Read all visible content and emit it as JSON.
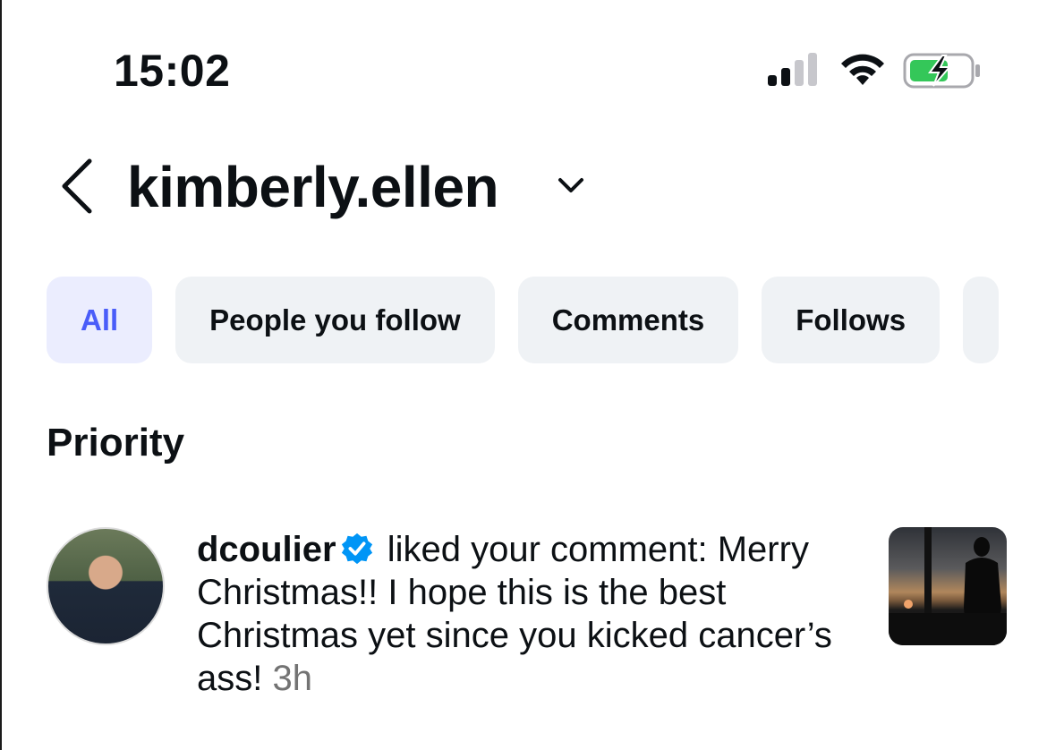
{
  "status_bar": {
    "time": "15:02",
    "icons": [
      "cellular-signal-icon",
      "wifi-icon",
      "battery-charging-icon"
    ],
    "battery_color": "#34c759"
  },
  "header": {
    "username": "kimberly.ellen",
    "icons": [
      "back-chevron-icon",
      "chevron-down-icon"
    ]
  },
  "tabs": [
    {
      "label": "All",
      "active": true
    },
    {
      "label": "People you follow",
      "active": false
    },
    {
      "label": "Comments",
      "active": false
    },
    {
      "label": "Follows",
      "active": false
    }
  ],
  "accent_color": "#4a5df9",
  "section": {
    "title": "Priority"
  },
  "notification": {
    "username": "dcoulier",
    "verified": true,
    "text": " liked your comment: Merry Christmas!! I hope this is the best Christmas yet since you kicked cancer’s ass! ",
    "time": "3h"
  }
}
